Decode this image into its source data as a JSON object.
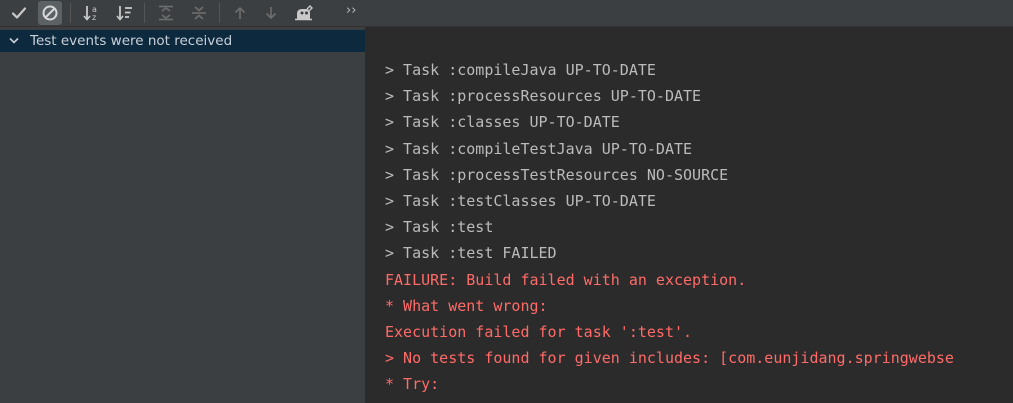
{
  "toolbar": {
    "items": [
      {
        "name": "show-passed-icon"
      },
      {
        "name": "show-ignored-icon"
      },
      {
        "name": "sort-alphabetically-icon"
      },
      {
        "name": "sort-by-duration-icon"
      },
      {
        "name": "expand-all-icon"
      },
      {
        "name": "collapse-all-icon"
      },
      {
        "name": "previous-failed-icon"
      },
      {
        "name": "next-failed-icon"
      },
      {
        "name": "import-tests-icon"
      }
    ],
    "more_label": "››"
  },
  "tree": {
    "root_label": "Test events were not received"
  },
  "console": {
    "lines": [
      {
        "text": "> Task :compileJava UP-TO-DATE",
        "kind": "normal"
      },
      {
        "text": "> Task :processResources UP-TO-DATE",
        "kind": "normal"
      },
      {
        "text": "> Task :classes UP-TO-DATE",
        "kind": "normal"
      },
      {
        "text": "> Task :compileTestJava UP-TO-DATE",
        "kind": "normal"
      },
      {
        "text": "> Task :processTestResources NO-SOURCE",
        "kind": "normal"
      },
      {
        "text": "> Task :testClasses UP-TO-DATE",
        "kind": "normal"
      },
      {
        "text": "> Task :test",
        "kind": "normal"
      },
      {
        "text": "> Task :test FAILED",
        "kind": "normal"
      },
      {
        "text": "FAILURE: Build failed with an exception.",
        "kind": "error"
      },
      {
        "text": "* What went wrong:",
        "kind": "error"
      },
      {
        "text": "Execution failed for task ':test'.",
        "kind": "error"
      },
      {
        "text": "> No tests found for given includes: [com.eunjidang.springwebse",
        "kind": "error"
      },
      {
        "text": "* Try:",
        "kind": "error"
      }
    ]
  },
  "colors": {
    "console_text": "#bbbbbb",
    "console_error": "#ff6b68",
    "selection": "#0d293e",
    "panel": "#3c3f41"
  }
}
